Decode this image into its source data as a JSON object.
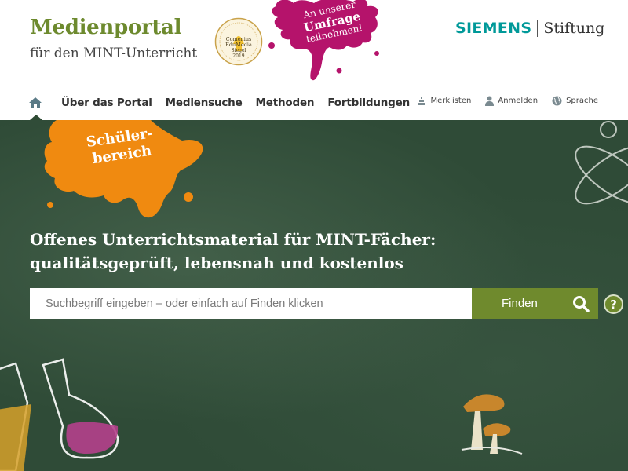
{
  "branding": {
    "title": "Medienportal",
    "subtitle": "für den MINT-Unterricht",
    "award_seal": "Comenius EduMedia Siegel 2019",
    "sponsor_name": "SIEMENS",
    "sponsor_suffix": "Stiftung"
  },
  "survey": {
    "line1": "An unserer",
    "line2": "Umfrage",
    "line3": "teilnehmen!"
  },
  "main_nav": {
    "home_icon": "home-icon",
    "items": [
      "Über das Portal",
      "Mediensuche",
      "Methoden",
      "Fortbildungen"
    ]
  },
  "util_nav": {
    "items": [
      {
        "label": "Merklisten",
        "icon": "bookmark-list-icon"
      },
      {
        "label": "Anmelden",
        "icon": "user-icon"
      },
      {
        "label": "Sprache",
        "icon": "globe-icon"
      }
    ]
  },
  "hero": {
    "student_area_line1": "Schüler-",
    "student_area_line2": "bereich",
    "headline_line1": "Offenes Unterrichtsmaterial für MINT-Fächer:",
    "headline_line2": "qualitätsgeprüft, lebensnah und kostenlos"
  },
  "search": {
    "placeholder": "Suchbegriff eingeben – oder einfach auf Finden klicken",
    "button_label": "Finden",
    "help_label": "?"
  },
  "colors": {
    "brand_green": "#6d8a2e",
    "chalkboard": "#2f4b37",
    "survey_magenta": "#b5136b",
    "student_orange": "#f08a10",
    "siemens_teal": "#009999"
  }
}
